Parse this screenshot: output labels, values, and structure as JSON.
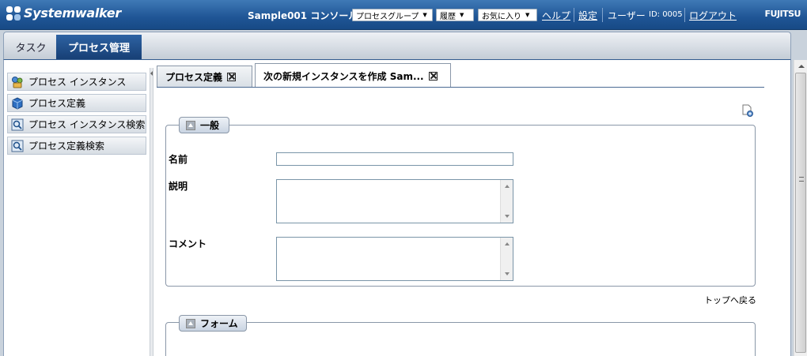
{
  "header": {
    "logo_text": "Systemwalker",
    "console_title": "Sample001 コンソール",
    "process_group_label": "プロセスグループ",
    "history_label": "履歴",
    "favorites_label": "お気に入り",
    "help_label": "ヘルプ",
    "settings_label": "設定",
    "user_label": "ユーザー",
    "user_id": "ID: 0005",
    "logout_label": "ログアウト",
    "brand": "FUJITSU"
  },
  "main_tabs": [
    {
      "label": "タスク",
      "active": false
    },
    {
      "label": "プロセス管理",
      "active": true
    }
  ],
  "sidebar": {
    "items": [
      {
        "label": "プロセス インスタンス",
        "icon": "process-instance-icon"
      },
      {
        "label": "プロセス定義",
        "icon": "process-definition-icon"
      },
      {
        "label": "プロセス インスタンス検索",
        "icon": "search-icon"
      },
      {
        "label": "プロセス定義検索",
        "icon": "search-icon"
      }
    ]
  },
  "content_tabs": [
    {
      "label": "プロセス定義",
      "active": false
    },
    {
      "label": "次の新規インスタンスを作成 Sam...",
      "active": true
    }
  ],
  "sections": {
    "general": {
      "title": "一般",
      "name_label": "名前",
      "name_value": "",
      "description_label": "説明",
      "description_value": "",
      "comment_label": "コメント",
      "comment_value": ""
    },
    "form": {
      "title": "フォーム"
    }
  },
  "back_to_top": "トップへ戻る",
  "colors": {
    "header_blue": "#1f5595",
    "active_tab": "#173f75",
    "border": "#8a97a8"
  }
}
